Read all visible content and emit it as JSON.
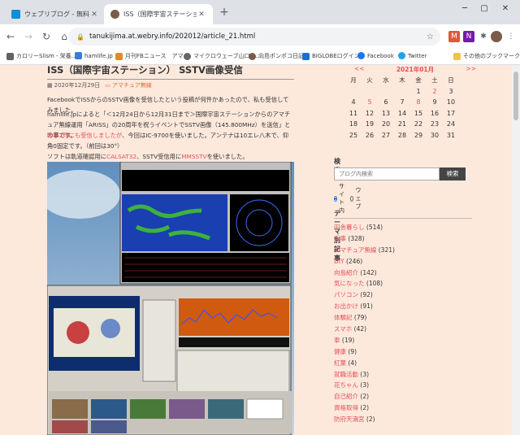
{
  "tabs": [
    {
      "title": "ウェブリブログ - 無料のブログ(blog)サ",
      "active": false
    },
    {
      "title": "ISS（国際宇宙ステーション） SSTV画",
      "active": true
    }
  ],
  "address": {
    "url": "tanukijima.at.webry.info/202012/article_21.html"
  },
  "bookmarks": [
    {
      "label": "カロリーSlism - 栄養..."
    },
    {
      "label": "hamlife.jp"
    },
    {
      "label": "月刊FBニュース　アマ..."
    },
    {
      "label": "マイクロウェーブ山口 -..."
    },
    {
      "label": "向島ポンポコ日記"
    },
    {
      "label": "BIGLOBEログイン"
    },
    {
      "label": "Facebook"
    },
    {
      "label": "Twitter"
    },
    {
      "label": "その他のブックマーク"
    }
  ],
  "post": {
    "title": "ISS（国際宇宙ステーション） SSTV画像受信",
    "date": "2020年12月29日",
    "category": "アマチュア無線",
    "p1": "FacebookでISSからのSSTV画像を受信したという投稿が何件かあったので、私も受信してみました。",
    "p2a": "hamlife.jpによると「＜12月24日から12月31日まで＞国際宇宙ステーションからのアマチュア無線運用「ARISS」の20周年を祝うイベントでSSTV画像（145.800MHz）を送信」との事です。",
    "p3red": "昨年2月にも受信しましたが",
    "p3": "、今回はIC-9700を使いました。アンテナは10エレ八木で、仰角0固定です。（前回は30°）",
    "p4a": "ソフトは軌道確認用に",
    "p4b": "CALSAT32",
    "p4c": "、SSTV受信用に",
    "p4d": "MMSSTV",
    "p4e": "を使いました。"
  },
  "calendar": {
    "prev": "<<",
    "month": "2021年01月",
    "next": ">>",
    "weekdays": [
      "月",
      "火",
      "水",
      "木",
      "金",
      "土",
      "日"
    ],
    "weeks": [
      [
        "",
        "",
        "",
        "",
        "1",
        "2",
        "3"
      ],
      [
        "4",
        "5",
        "6",
        "7",
        "8",
        "9",
        "10"
      ],
      [
        "11",
        "12",
        "13",
        "14",
        "15",
        "16",
        "17"
      ],
      [
        "18",
        "19",
        "20",
        "21",
        "22",
        "23",
        "24"
      ],
      [
        "25",
        "26",
        "27",
        "28",
        "29",
        "30",
        "31"
      ]
    ]
  },
  "search": {
    "title": "検索",
    "placeholder": "ブログ内検索",
    "button": "検索",
    "opt_site": "サイト内",
    "opt_web": "ウェブ"
  },
  "categories": {
    "title": "テーマ別記事",
    "items": [
      {
        "label": "田舎暮らし",
        "count": "(514)"
      },
      {
        "label": "兵事",
        "count": "(328)"
      },
      {
        "label": "アマチュア無線",
        "count": "(321)"
      },
      {
        "label": "DIY",
        "count": "(246)"
      },
      {
        "label": "向島紹介",
        "count": "(142)"
      },
      {
        "label": "気になった",
        "count": "(108)"
      },
      {
        "label": "パソコン",
        "count": "(92)"
      },
      {
        "label": "お出かけ",
        "count": "(91)"
      },
      {
        "label": "体験記",
        "count": "(79)"
      },
      {
        "label": "スマホ",
        "count": "(42)"
      },
      {
        "label": "車",
        "count": "(19)"
      },
      {
        "label": "健康",
        "count": "(9)"
      },
      {
        "label": "紅葉",
        "count": "(4)"
      },
      {
        "label": "就職活動",
        "count": "(3)"
      },
      {
        "label": "花ちゃん",
        "count": "(3)"
      },
      {
        "label": "自己紹介",
        "count": "(2)"
      },
      {
        "label": "資格取得",
        "count": "(2)"
      },
      {
        "label": "防府天満宮",
        "count": "(2)"
      }
    ]
  }
}
